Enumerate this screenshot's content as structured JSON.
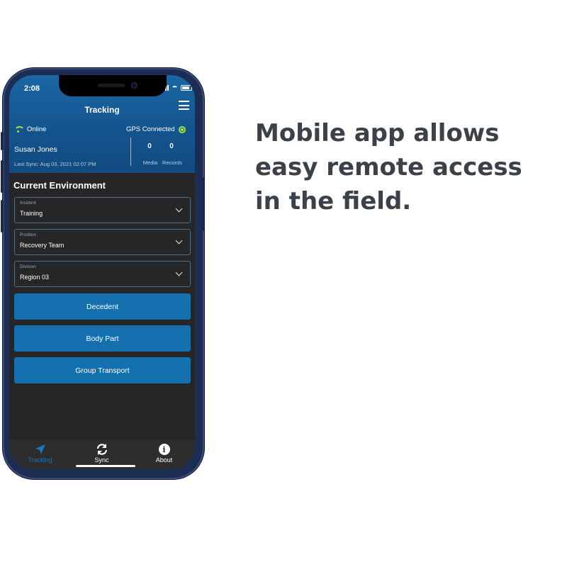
{
  "status_bar": {
    "time": "2:08"
  },
  "header": {
    "title": "Tracking",
    "connection_status": "Online",
    "gps_status": "GPS Connected",
    "user_name": "Susan Jones",
    "last_sync": "Last Sync:  Aug 03, 2021 02:07 PM",
    "media_count": "0",
    "media_label": "Media",
    "records_count": "0",
    "records_label": "Records"
  },
  "environment": {
    "section_title": "Current Environment",
    "fields": [
      {
        "label": "Incident",
        "value": "Training"
      },
      {
        "label": "Position",
        "value": "Recovery Team"
      },
      {
        "label": "Division",
        "value": "Region 03"
      }
    ]
  },
  "actions": [
    {
      "label": "Decedent"
    },
    {
      "label": "Body Part"
    },
    {
      "label": "Group Transport"
    }
  ],
  "tabbar": {
    "items": [
      {
        "label": "Tracking",
        "icon": "navigation-arrow-icon",
        "active": true
      },
      {
        "label": "Sync",
        "icon": "sync-icon",
        "active": false
      },
      {
        "label": "About",
        "icon": "info-icon",
        "active": false
      }
    ]
  },
  "headline": "Mobile app allows easy remote access in the field.",
  "colors": {
    "header_blue": "#14558f",
    "button_blue": "#1570b0",
    "status_green": "#9ee53c",
    "screen_bg": "#262626",
    "headline_text": "#3b4148"
  }
}
